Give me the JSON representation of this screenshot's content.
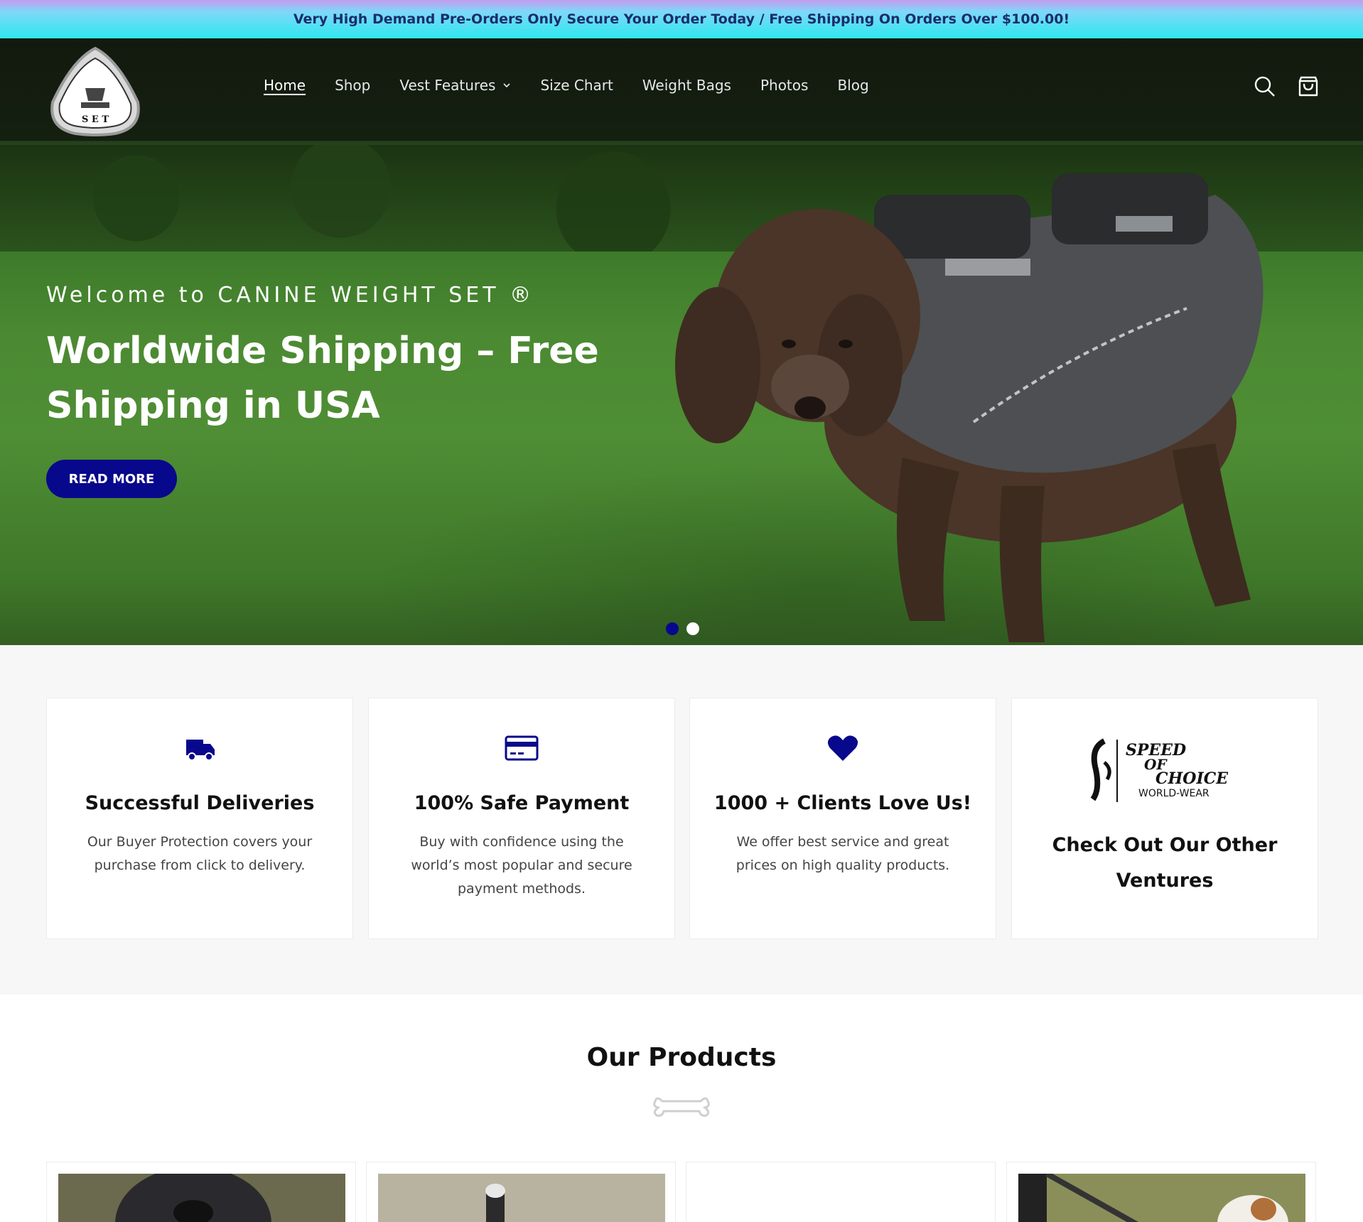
{
  "announcement": {
    "text": "Very High Demand Pre-Orders Only Secure Your Order Today / Free Shipping On Orders Over $100.00!"
  },
  "header": {
    "logo": {
      "alt": "CANINE WEIGHT SET"
    },
    "nav": [
      {
        "label": "Home",
        "active": true
      },
      {
        "label": "Shop"
      },
      {
        "label": "Vest Features",
        "has_dropdown": true
      },
      {
        "label": "Size Chart"
      },
      {
        "label": "Weight Bags"
      },
      {
        "label": "Photos"
      },
      {
        "label": "Blog"
      }
    ],
    "icons": [
      "search-icon",
      "cart-icon"
    ]
  },
  "hero": {
    "kicker": "Welcome to CANINE WEIGHT SET ®",
    "title": "Worldwide Shipping – Free Shipping in USA",
    "cta": "READ MORE",
    "slide_count": 2,
    "active_slide": 1
  },
  "features": [
    {
      "icon": "truck-icon",
      "title": "Successful Deliveries",
      "text": "Our Buyer Protection covers your purchase from click to delivery."
    },
    {
      "icon": "credit-card-icon",
      "title": "100% Safe Payment",
      "text": "Buy with confidence using the world’s most popular and secure payment methods."
    },
    {
      "icon": "heart-icon",
      "title": "1000 + Clients Love Us!",
      "text": "We offer best service and great prices on high quality products."
    },
    {
      "logo_lines": [
        "SPEED",
        "OF",
        "CHOICE",
        "WORLD-WEAR"
      ],
      "title": "Check Out Our Other Ventures"
    }
  ],
  "products": {
    "heading": "Our Products",
    "divider_icon": "bone-icon"
  },
  "colors": {
    "brand_blue": "#08088c",
    "announce_text": "#1a2d6b",
    "dot_inactive": "#ffffff"
  }
}
